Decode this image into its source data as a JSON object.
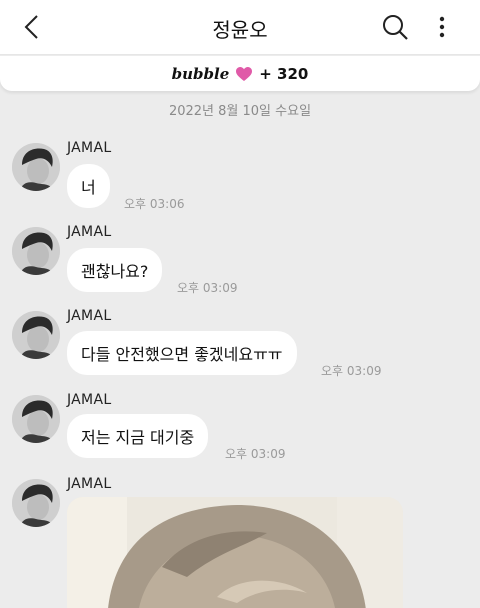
{
  "header": {
    "title": "정윤오",
    "back_icon": "chevron-left-icon",
    "search_icon": "search-icon",
    "more_icon": "more-vertical-icon"
  },
  "banner": {
    "logo_text": "bubble",
    "heart_icon": "heart-icon",
    "heart_color": "#e05aa8",
    "count_text": "+ 320"
  },
  "date_divider": "2022년 8월 10일 수요일",
  "messages": [
    {
      "sender": "JAMAL",
      "text": "너",
      "time": "오후 03:06"
    },
    {
      "sender": "JAMAL",
      "text": "괜찮나요?",
      "time": "오후 03:09"
    },
    {
      "sender": "JAMAL",
      "text": "다들 안전했으면 좋겠네요ㅠㅠ",
      "time": "오후 03:09"
    },
    {
      "sender": "JAMAL",
      "text": "저는 지금 대기중",
      "time": "오후 03:09"
    },
    {
      "sender": "JAMAL",
      "type": "photo"
    }
  ]
}
